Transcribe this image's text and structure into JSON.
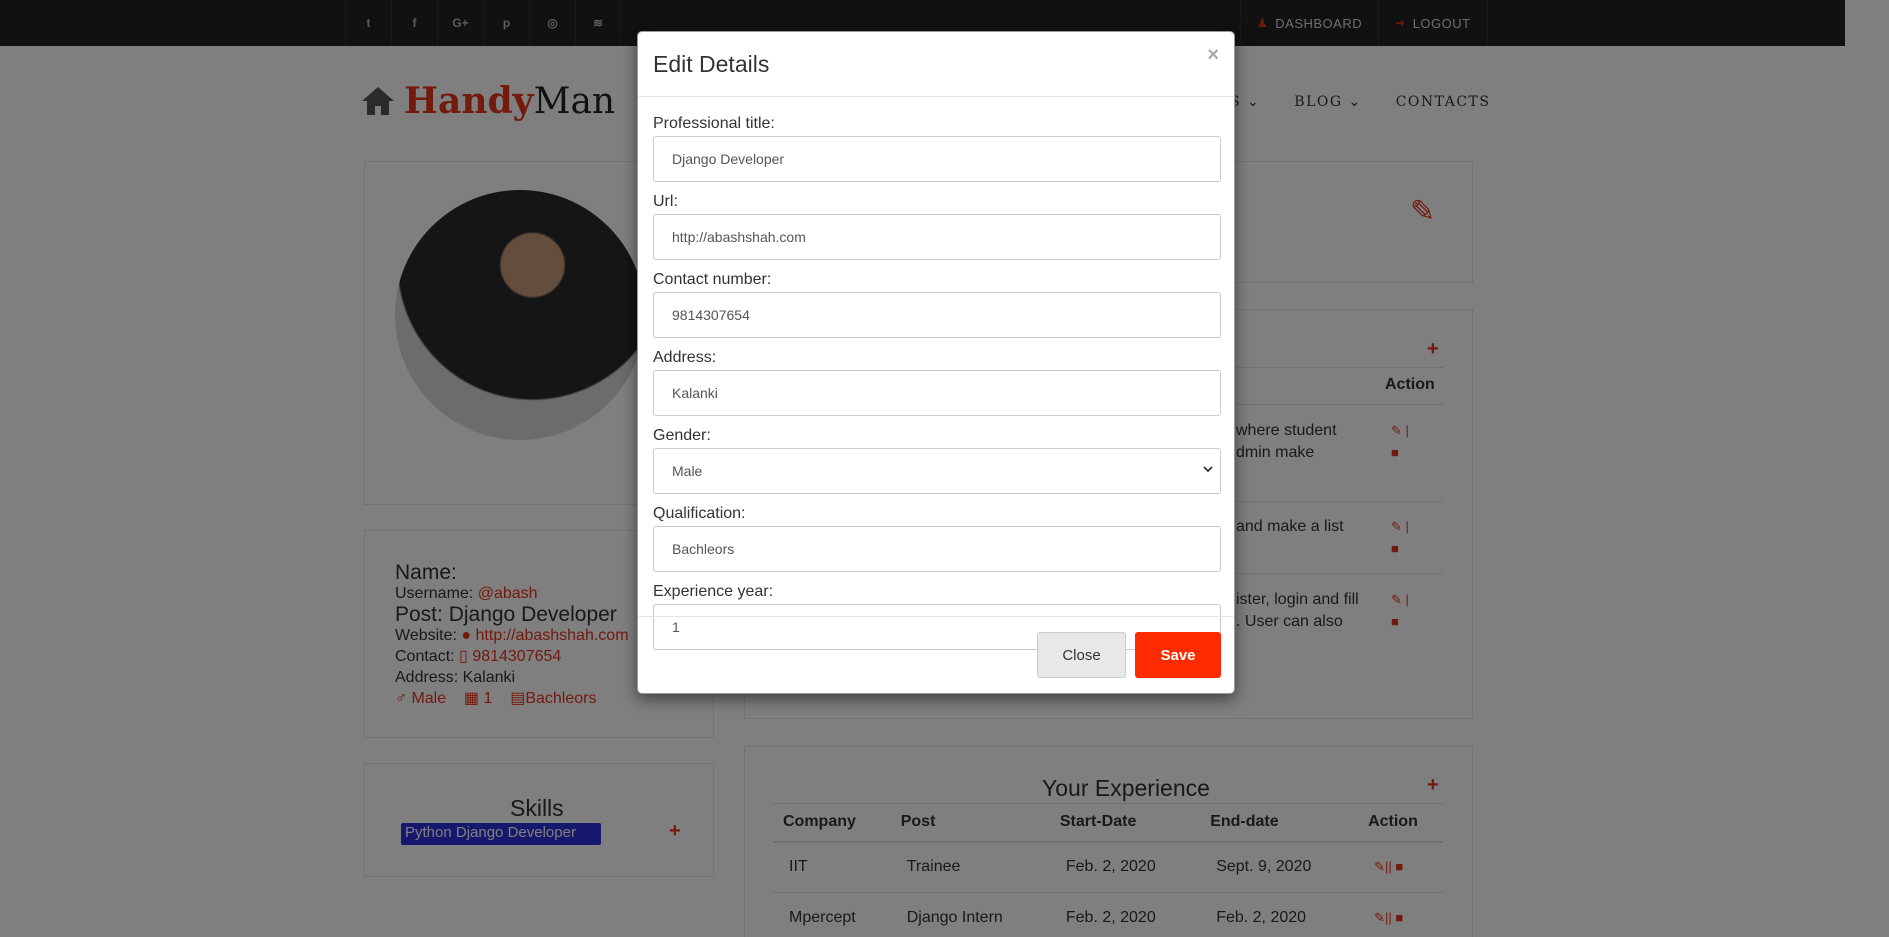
{
  "social_icons": [
    {
      "name": "twitter-icon",
      "glyph": "t"
    },
    {
      "name": "facebook-icon",
      "glyph": "f"
    },
    {
      "name": "google-plus-icon",
      "glyph": "G+"
    },
    {
      "name": "pinterest-icon",
      "glyph": "p"
    },
    {
      "name": "instagram-icon",
      "glyph": "◎"
    },
    {
      "name": "rss-icon",
      "glyph": "≋"
    }
  ],
  "topbar": {
    "dashboard_label": "DASHBOARD",
    "logout_label": "LOGOUT"
  },
  "logo": {
    "part1": "Handy",
    "part2": "Man"
  },
  "nav": {
    "partial": "S ⌄",
    "blog": "BLOG ⌄",
    "contacts": "CONTACTS"
  },
  "profile": {
    "name_label": "Name:",
    "username_label": "Username:",
    "username": "@abash",
    "post": "Post: Django Developer",
    "website_label": "Website:",
    "website": "http://abashshah.com",
    "contact_label": "Contact:",
    "contact": "9814307654",
    "address": "Address: Kalanki",
    "gender": "Male",
    "experience": "1",
    "qualification": "Bachleors"
  },
  "skills": {
    "title": "Skills",
    "items": [
      "Python Django Developer"
    ]
  },
  "projects": {
    "action_header": "Action",
    "rows": [
      {
        "line1": "where student",
        "line2": "dmin make"
      },
      {
        "line1": "and make a list",
        "line2": ""
      },
      {
        "line1": "ister, login and fill",
        "line2": ". User can also"
      }
    ]
  },
  "experience": {
    "title": "Your Experience",
    "columns": [
      "Company",
      "Post",
      "Start-Date",
      "End-date",
      "Action"
    ],
    "rows": [
      [
        "IIT",
        "Trainee",
        "Feb. 2, 2020",
        "Sept. 9, 2020"
      ],
      [
        "Mpercept",
        "Django Intern",
        "Feb. 2, 2020",
        "Feb. 2, 2020"
      ]
    ]
  },
  "modal": {
    "title": "Edit Details",
    "close_x": "×",
    "fields": {
      "professional_title": {
        "label": "Professional title:",
        "value": "Django Developer"
      },
      "url": {
        "label": "Url:",
        "value": "http://abashshah.com"
      },
      "contact_number": {
        "label": "Contact number:",
        "value": "9814307654"
      },
      "address": {
        "label": "Address:",
        "value": "Kalanki"
      },
      "gender": {
        "label": "Gender:",
        "value": "Male"
      },
      "qualification": {
        "label": "Qualification:",
        "value": "Bachleors"
      },
      "experience_year": {
        "label": "Experience year:",
        "value": "1"
      }
    },
    "close_button": "Close",
    "save_button": "Save"
  },
  "colors": {
    "accent": "#e8331a",
    "save": "#ff2b00",
    "skill_badge": "#2b30d8"
  }
}
